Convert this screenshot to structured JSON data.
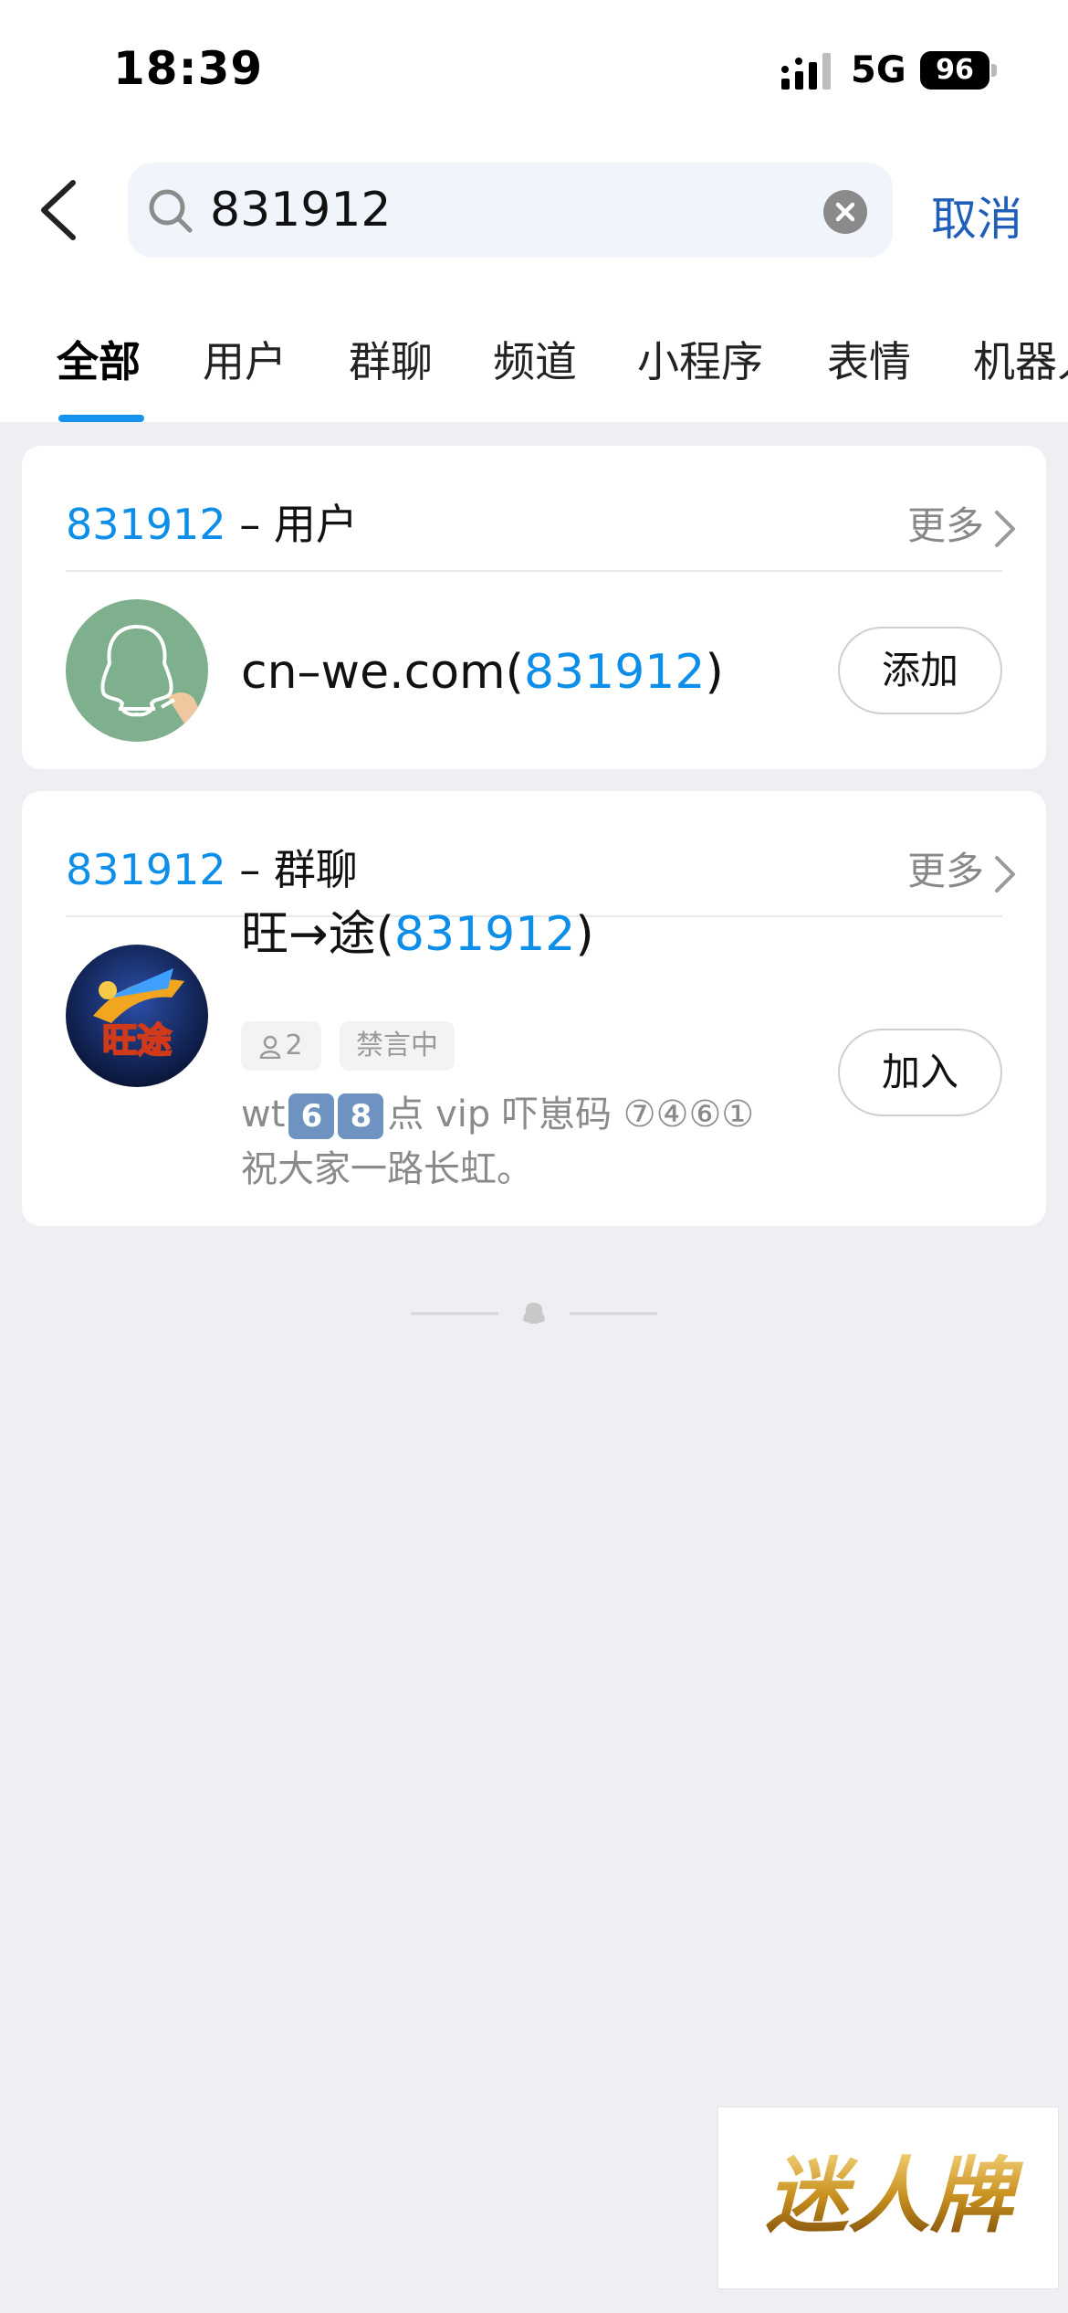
{
  "status_bar": {
    "time": "18:39",
    "network": "5G",
    "battery": "96"
  },
  "search": {
    "query": "831912",
    "cancel_label": "取消"
  },
  "tabs": [
    "全部",
    "用户",
    "群聊",
    "频道",
    "小程序",
    "表情",
    "机器人"
  ],
  "user_section": {
    "keyword": "831912",
    "title_suffix": " – 用户",
    "more_label": "更多",
    "result": {
      "name_prefix": "cn–we.com(",
      "id": "831912",
      "name_suffix": ")",
      "action_label": "添加"
    }
  },
  "group_section": {
    "keyword": "831912",
    "title_suffix": " – 群聊",
    "more_label": "更多",
    "result": {
      "name_prefix": "旺→途(",
      "id": "831912",
      "name_suffix": ")",
      "member_count": "2",
      "status_tag": "禁言中",
      "desc_line1_prefix": "wt",
      "desc_digit1": "6",
      "desc_digit2": "8",
      "desc_line1_suffix": "点 vip 吓崽码 ⑦④⑥①",
      "desc_line2": "祝大家一路长虹。",
      "avatar_text": "旺途",
      "action_label": "加入"
    }
  },
  "watermark": {
    "text": "迷人牌"
  },
  "colors": {
    "accent": "#0d8ee9",
    "cancel": "#1f5eb9",
    "tab_indicator": "#1494ec",
    "page_bg": "#eeeff3"
  }
}
